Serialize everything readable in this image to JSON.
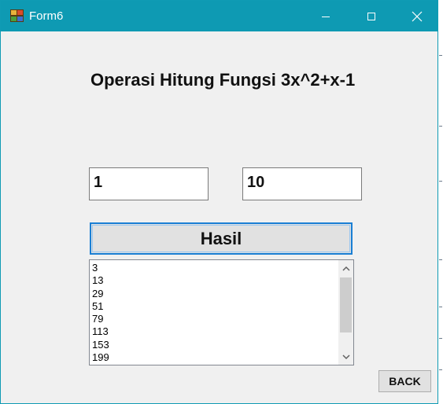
{
  "window": {
    "title": "Form6",
    "icon": "form-app-icon",
    "controls": [
      "minimize-icon",
      "maximize-icon",
      "close-icon"
    ]
  },
  "heading": "Operasi Hitung Fungsi 3x^2+x-1",
  "inputs": {
    "start_value": "1",
    "end_value": "10"
  },
  "hasil_button": "Hasil",
  "results": [
    "3",
    "13",
    "29",
    "51",
    "79",
    "113",
    "153",
    "199"
  ],
  "back_button": "BACK",
  "colors": {
    "titlebar": "#0e9ab3",
    "form_background": "#f0f0f0",
    "focus_border": "#1a7fd4"
  }
}
